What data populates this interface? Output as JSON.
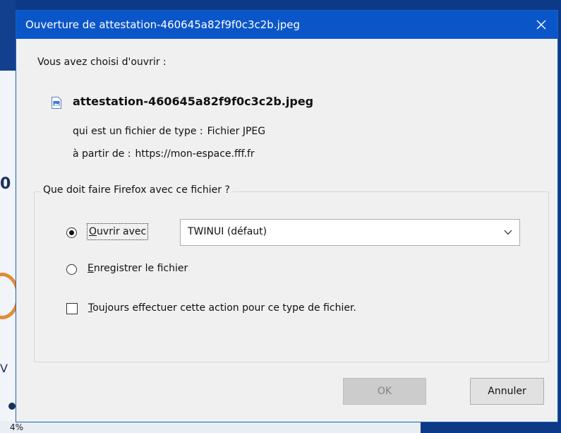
{
  "background": {
    "percent_text": "4%"
  },
  "dialog": {
    "title": "Ouverture de attestation-460645a82f9f0c3c2b.jpeg",
    "intro": "Vous avez choisi d'ouvrir :",
    "file_name": "attestation-460645a82f9f0c3c2b.jpeg",
    "file_icon": "image-file-icon",
    "type_label": "qui est un fichier de type :",
    "type_value": "Fichier JPEG",
    "from_label": "à partir de :",
    "from_value": "https://mon-espace.fff.fr",
    "group_legend": "Que doit faire Firefox avec ce fichier ?",
    "open_with": {
      "label_first": "O",
      "label_rest": "uvrir avec",
      "selected": true,
      "app_value": "TWINUI (défaut)"
    },
    "save": {
      "label_first": "E",
      "label_rest": "nregistrer le fichier",
      "selected": false
    },
    "always": {
      "label_first": "T",
      "label_rest": "oujours effectuer cette action pour ce type de fichier.",
      "checked": false
    },
    "buttons": {
      "ok": "OK",
      "cancel": "Annuler"
    }
  },
  "colors": {
    "titlebar": "#0a56c9",
    "dialog_bg": "#f0f0f0",
    "desktop_bg": "#0d3a86"
  }
}
